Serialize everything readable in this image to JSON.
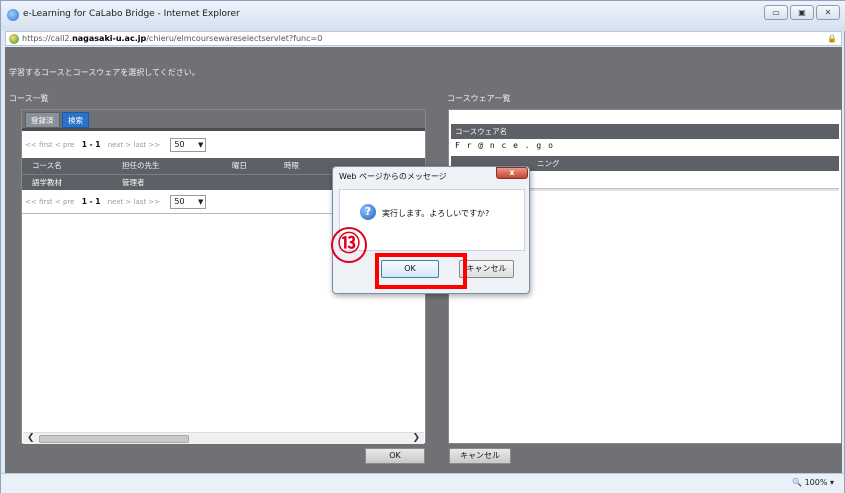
{
  "window": {
    "title": "e-Learning for CaLabo Bridge - Internet Explorer",
    "url_prefix": "https://call2.",
    "url_domain": "nagasaki-u.ac.jp",
    "url_path": "/chieru/elmcoursewareselectservlet?func=0",
    "controls": [
      "▭",
      "▣",
      "✕"
    ]
  },
  "page": {
    "instruction": "学習するコースとコースウェアを選択してください。",
    "course_list_label": "コース一覧",
    "courseware_list_label": "コースウェア一覧"
  },
  "tabs": [
    {
      "label": "登録済"
    },
    {
      "label": "検索"
    }
  ],
  "pager": {
    "first": "<< first",
    "prev": "< pre",
    "range": "1 - 1",
    "next": "next >",
    "last": "last >>",
    "page_size": "50"
  },
  "course_table": {
    "headers": [
      "コース名",
      "担任の先生",
      "曜日",
      "時限"
    ],
    "rows": [
      [
        "語学教材",
        "管理者",
        "",
        ""
      ]
    ]
  },
  "courseware": {
    "header": "コースウェア名",
    "items": [
      "F r @ n c e . g o"
    ],
    "header2": "ニング"
  },
  "buttons": {
    "ok": "OK",
    "cancel": "キャンセル"
  },
  "dialog": {
    "title": "Web ページからのメッセージ",
    "close": "x",
    "message": "実行します。よろしいですか?",
    "ok": "OK",
    "cancel": "キャンセル"
  },
  "annotation": {
    "step": "⑬"
  },
  "status": {
    "zoom": "100%"
  }
}
